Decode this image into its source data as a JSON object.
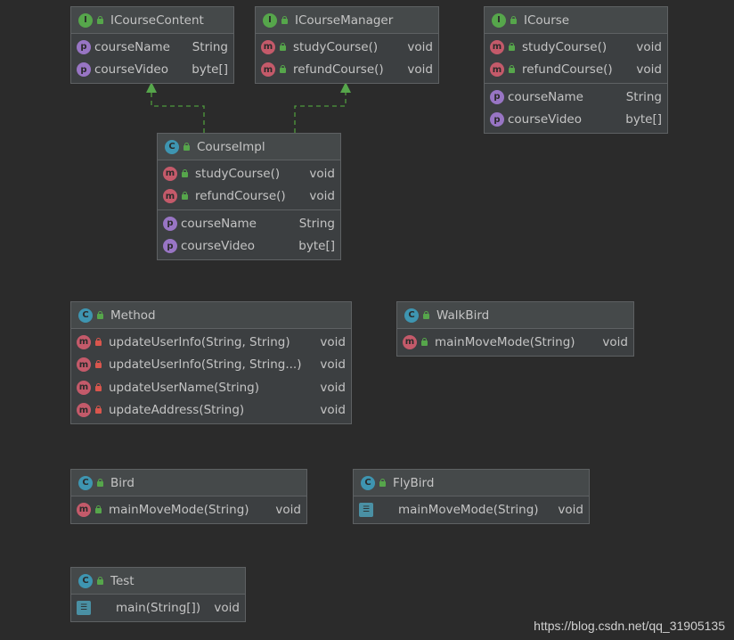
{
  "classes": [
    {
      "id": "icoursecontent",
      "kind": "interface",
      "name": "ICourseContent",
      "sections": [
        [
          {
            "icon": "p",
            "vis": "",
            "name": "courseName",
            "type": "String"
          },
          {
            "icon": "p",
            "vis": "",
            "name": "courseVideo",
            "type": "byte[]"
          }
        ]
      ]
    },
    {
      "id": "icoursemanager",
      "kind": "interface",
      "name": "ICourseManager",
      "sections": [
        [
          {
            "icon": "m",
            "vis": "pub",
            "name": "studyCourse()",
            "type": "void"
          },
          {
            "icon": "m",
            "vis": "pub",
            "name": "refundCourse()",
            "type": "void"
          }
        ]
      ]
    },
    {
      "id": "icourse",
      "kind": "interface",
      "name": "ICourse",
      "sections": [
        [
          {
            "icon": "m",
            "vis": "pub",
            "name": "studyCourse()",
            "type": "void"
          },
          {
            "icon": "m",
            "vis": "pub",
            "name": "refundCourse()",
            "type": "void"
          }
        ],
        [
          {
            "icon": "p",
            "vis": "",
            "name": "courseName",
            "type": "String"
          },
          {
            "icon": "p",
            "vis": "",
            "name": "courseVideo",
            "type": "byte[]"
          }
        ]
      ]
    },
    {
      "id": "courseimpl",
      "kind": "class",
      "name": "CourseImpl",
      "sections": [
        [
          {
            "icon": "m",
            "vis": "pub",
            "name": "studyCourse()",
            "type": "void"
          },
          {
            "icon": "m",
            "vis": "pub",
            "name": "refundCourse()",
            "type": "void"
          }
        ],
        [
          {
            "icon": "p",
            "vis": "",
            "name": "courseName",
            "type": "String"
          },
          {
            "icon": "p",
            "vis": "",
            "name": "courseVideo",
            "type": "byte[]"
          }
        ]
      ]
    },
    {
      "id": "method",
      "kind": "class",
      "name": "Method",
      "sections": [
        [
          {
            "icon": "m",
            "vis": "priv",
            "name": "updateUserInfo(String, String)",
            "type": "void"
          },
          {
            "icon": "m",
            "vis": "priv",
            "name": "updateUserInfo(String, String...)",
            "type": "void"
          },
          {
            "icon": "m",
            "vis": "priv",
            "name": "updateUserName(String)",
            "type": "void"
          },
          {
            "icon": "m",
            "vis": "priv",
            "name": "updateAddress(String)",
            "type": "void"
          }
        ]
      ]
    },
    {
      "id": "walkbird",
      "kind": "class",
      "name": "WalkBird",
      "sections": [
        [
          {
            "icon": "m",
            "vis": "pub",
            "name": "mainMoveMode(String)",
            "type": "void"
          }
        ]
      ]
    },
    {
      "id": "bird",
      "kind": "class",
      "name": "Bird",
      "sections": [
        [
          {
            "icon": "m",
            "vis": "pub",
            "name": "mainMoveMode(String)",
            "type": "void"
          }
        ]
      ]
    },
    {
      "id": "flybird",
      "kind": "class",
      "name": "FlyBird",
      "sections": [
        [
          {
            "icon": "static",
            "vis": "",
            "name": "mainMoveMode(String)",
            "type": "void"
          }
        ]
      ]
    },
    {
      "id": "test",
      "kind": "class",
      "name": "Test",
      "sections": [
        [
          {
            "icon": "static",
            "vis": "",
            "name": "main(String[])",
            "type": "void"
          }
        ]
      ]
    }
  ],
  "relations": [
    {
      "from": "courseimpl",
      "to": "icoursecontent",
      "type": "implements"
    },
    {
      "from": "courseimpl",
      "to": "icoursemanager",
      "type": "implements"
    }
  ],
  "colors": {
    "background": "#2b2b2b",
    "edge": "#4e9a3d"
  },
  "watermark": "https://blog.csdn.net/qq_31905135"
}
